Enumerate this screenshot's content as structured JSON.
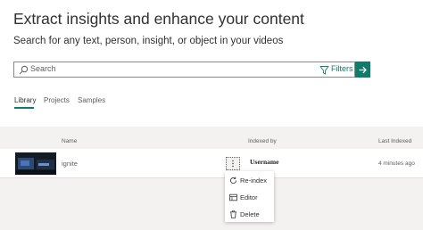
{
  "header": {
    "title": "Extract insights and enhance your content",
    "subtitle": "Search for any text, person, insight, or object in your videos"
  },
  "search": {
    "placeholder": "Search",
    "filters_label": "Filters",
    "icon": "search-icon",
    "filter_icon": "filter-icon",
    "go_icon": "arrow-right-icon"
  },
  "tabs": [
    {
      "label": "Library",
      "active": true
    },
    {
      "label": "Projects",
      "active": false
    },
    {
      "label": "Samples",
      "active": false
    }
  ],
  "table": {
    "columns": [
      "Name",
      "Indexed by",
      "Last Indexed"
    ],
    "rows": [
      {
        "name": "ignite",
        "indexed_by": "Username",
        "last_indexed": "4 minutes ago"
      }
    ]
  },
  "context_menu": {
    "items": [
      {
        "label": "Re-index",
        "icon": "refresh-icon"
      },
      {
        "label": "Editor",
        "icon": "editor-icon"
      },
      {
        "label": "Delete",
        "icon": "trash-icon"
      }
    ]
  },
  "colors": {
    "accent": "#0f7b6c",
    "band": "#f3f2f1",
    "text": "#323130",
    "muted": "#605e5c"
  }
}
